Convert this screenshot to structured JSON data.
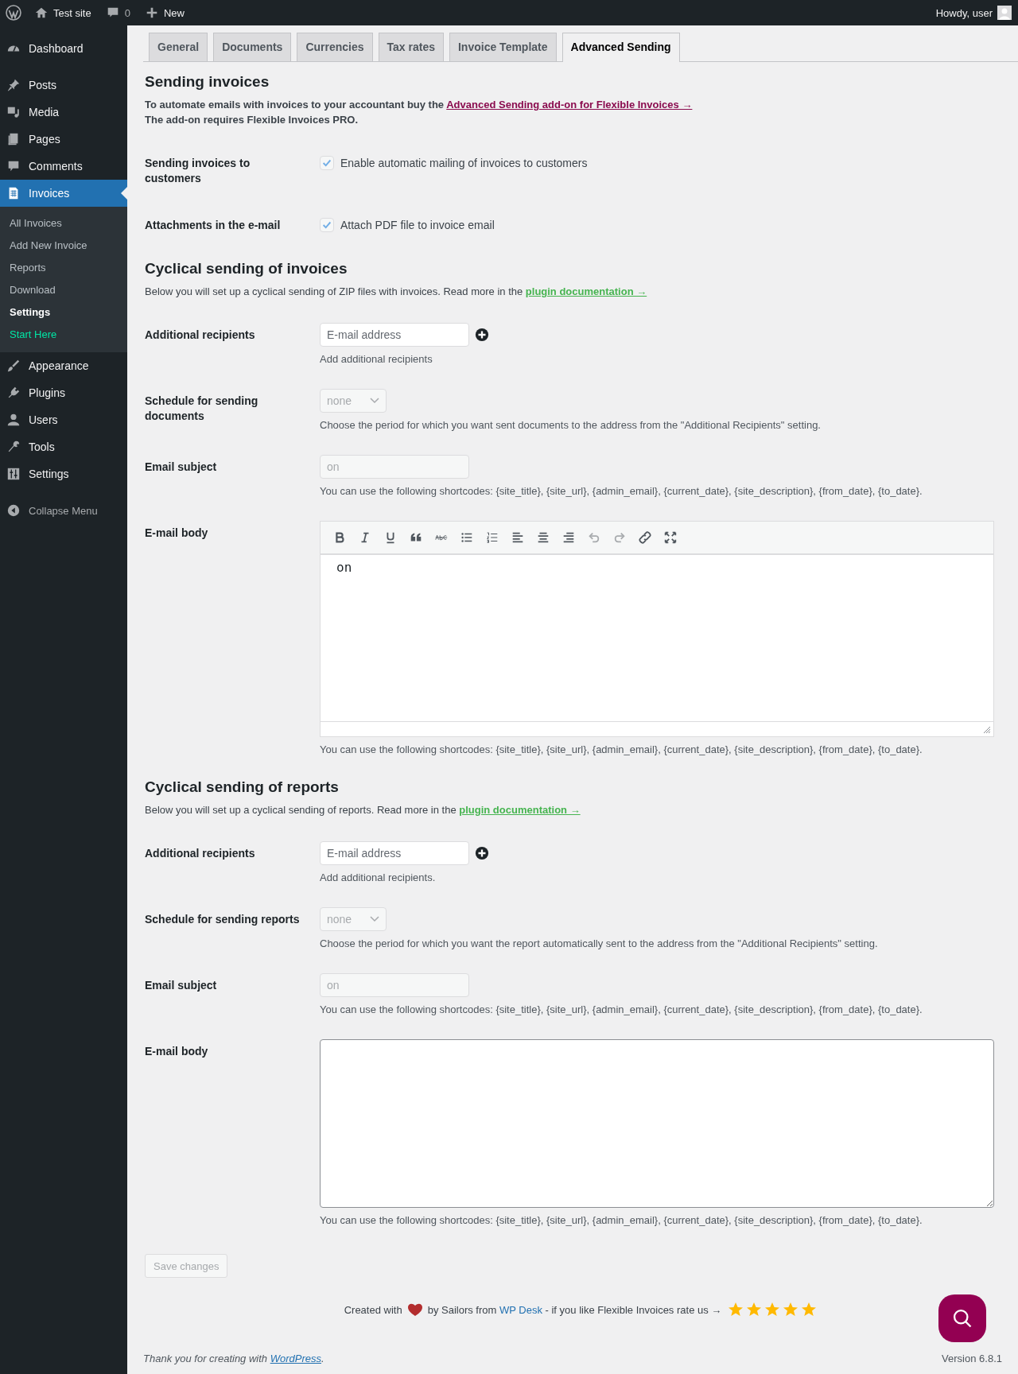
{
  "admin_bar": {
    "site": "Test site",
    "comments": "0",
    "new": "New",
    "greeting": "Howdy, user"
  },
  "sidebar": {
    "groups": [
      [
        {
          "label": "Dashboard",
          "selected": false
        }
      ],
      [
        {
          "label": "Posts",
          "selected": false
        },
        {
          "label": "Media",
          "selected": false
        },
        {
          "label": "Pages",
          "selected": false
        },
        {
          "label": "Comments",
          "selected": false
        },
        {
          "label": "Invoices",
          "selected": true,
          "children": [
            {
              "label": "All Invoices",
              "kind": "link",
              "selected": false
            },
            {
              "label": "Add New Invoice",
              "kind": "link",
              "selected": false
            },
            {
              "label": "Reports",
              "kind": "link",
              "selected": false
            },
            {
              "label": "Download",
              "kind": "link",
              "selected": false
            },
            {
              "label": "Settings",
              "kind": "link",
              "selected": true
            },
            {
              "label": "Start Here",
              "kind": "promo",
              "selected": false
            }
          ]
        },
        {
          "label": "Appearance",
          "selected": false
        },
        {
          "label": "Plugins",
          "selected": false
        },
        {
          "label": "Users",
          "selected": false
        },
        {
          "label": "Tools",
          "selected": false
        },
        {
          "label": "Settings",
          "selected": false
        }
      ]
    ],
    "collapse": "Collapse Menu"
  },
  "tabs": [
    {
      "label": "General",
      "selected": false
    },
    {
      "label": "Documents",
      "selected": false
    },
    {
      "label": "Currencies",
      "selected": false
    },
    {
      "label": "Tax rates",
      "selected": false
    },
    {
      "label": "Invoice Template",
      "selected": false
    },
    {
      "label": "Advanced Sending",
      "selected": true
    }
  ],
  "sections": [
    {
      "title": "Sending invoices",
      "intro": {
        "emphasis": true,
        "text": "To automate emails with invoices to your accountant buy the",
        "link": "Advanced Sending add-on for Flexible Invoices →",
        "note": "The add-on requires Flexible Invoices PRO."
      },
      "fields": [
        {
          "kind": "checkbox",
          "label": "Sending invoices to customers",
          "text": "Enable automatic mailing of invoices to customers",
          "checked": true
        },
        {
          "kind": "checkbox",
          "label": "Attachments in the e-mail",
          "text": "Attach PDF file to invoice email",
          "checked": true
        }
      ]
    },
    {
      "title": "Cyclical sending of invoices",
      "intro": {
        "emphasis": false,
        "text": "Below you will set up a cyclical sending of ZIP files with invoices. Read more in the",
        "link": "plugin documentation →"
      },
      "fields": [
        {
          "kind": "recipients",
          "label": "Additional recipients",
          "placeholder": "E-mail address",
          "help": "Add additional recipients"
        },
        {
          "kind": "select",
          "label": "Schedule for sending documents",
          "value": "none",
          "disabled": true,
          "help": "Choose the period for which you want sent documents to the address from the \"Additional Recipients\" setting."
        },
        {
          "kind": "text",
          "label": "Email subject",
          "value": "on",
          "disabled": true,
          "help": "You can use the following shortcodes: {site_title}, {site_url}, {admin_email}, {current_date}, {site_description}, {from_date}, {to_date}."
        },
        {
          "kind": "editor",
          "label": "E-mail body",
          "value": "on",
          "toolbar": [
            {
              "disabled": false
            },
            {
              "disabled": false
            },
            {
              "disabled": false
            },
            {
              "disabled": false
            },
            {
              "disabled": false
            },
            {
              "disabled": false
            },
            {
              "disabled": false
            },
            {
              "disabled": false
            },
            {
              "disabled": false
            },
            {
              "disabled": false
            },
            {
              "disabled": true
            },
            {
              "disabled": true
            },
            {
              "disabled": false
            },
            {
              "disabled": false
            }
          ],
          "help": "You can use the following shortcodes: {site_title}, {site_url}, {admin_email}, {current_date}, {site_description}, {from_date}, {to_date}."
        }
      ]
    },
    {
      "title": "Cyclical sending of reports",
      "intro": {
        "emphasis": false,
        "text": "Below you will set up a cyclical sending of reports. Read more in the",
        "link": "plugin documentation →"
      },
      "fields": [
        {
          "kind": "recipients",
          "label": "Additional recipients",
          "placeholder": "E-mail address",
          "help": "Add additional recipients."
        },
        {
          "kind": "select",
          "label": "Schedule for sending reports",
          "value": "none",
          "disabled": true,
          "help": "Choose the period for which you want the report automatically sent to the address from the \"Additional Recipients\" setting."
        },
        {
          "kind": "text",
          "label": "Email subject",
          "value": "on",
          "disabled": true,
          "help": "You can use the following shortcodes: {site_title}, {site_url}, {admin_email}, {current_date}, {site_description}, {from_date}, {to_date}."
        },
        {
          "kind": "textarea",
          "label": "E-mail body",
          "help": "You can use the following shortcodes: {site_title}, {site_url}, {admin_email}, {current_date}, {site_description}, {from_date}, {to_date}."
        }
      ]
    }
  ],
  "save": {
    "label": "Save changes",
    "disabled": true
  },
  "credits": {
    "before": "Created with",
    "middle": "by Sailors from",
    "link": "WP Desk",
    "after": "- if you like Flexible Invoices rate us →",
    "stars": 5
  },
  "footer": {
    "text": "Thank you for creating with",
    "link": "WordPress",
    "end": ".",
    "version": "Version 6.8.1"
  }
}
